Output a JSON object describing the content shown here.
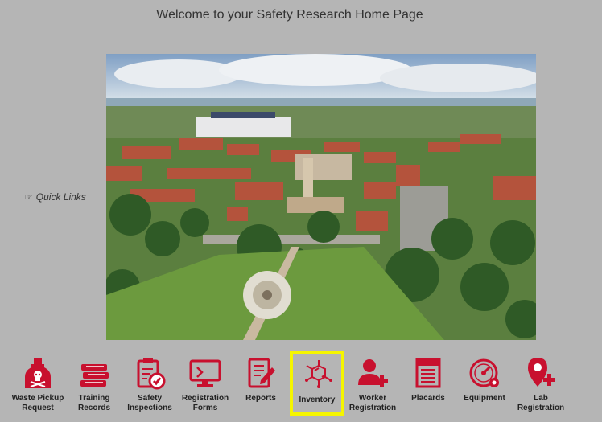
{
  "header": {
    "title": "Welcome to your Safety Research Home Page"
  },
  "sidebar": {
    "quick_links": "Quick Links"
  },
  "hero": {
    "alt": "Campus aerial view"
  },
  "toolbar": {
    "items": [
      {
        "label": "Waste Pickup\nRequest",
        "icon": "bottle-skull-icon"
      },
      {
        "label": "Training\nRecords",
        "icon": "books-icon"
      },
      {
        "label": "Safety\nInspections",
        "icon": "clipboard-check-icon"
      },
      {
        "label": "Registration\nForms",
        "icon": "monitor-icon"
      },
      {
        "label": "Reports",
        "icon": "report-pencil-icon"
      },
      {
        "label": "Inventory",
        "icon": "molecule-icon",
        "selected": true
      },
      {
        "label": "Worker\nRegistration",
        "icon": "user-plus-icon"
      },
      {
        "label": "Placards",
        "icon": "caution-placard-icon"
      },
      {
        "label": "Equipment",
        "icon": "gauge-icon"
      },
      {
        "label": "Lab\nRegistration",
        "icon": "map-pin-plus-icon"
      }
    ]
  },
  "colors": {
    "accent": "#c8102e",
    "highlight": "#f5f500",
    "background": "#b5b5b5"
  }
}
